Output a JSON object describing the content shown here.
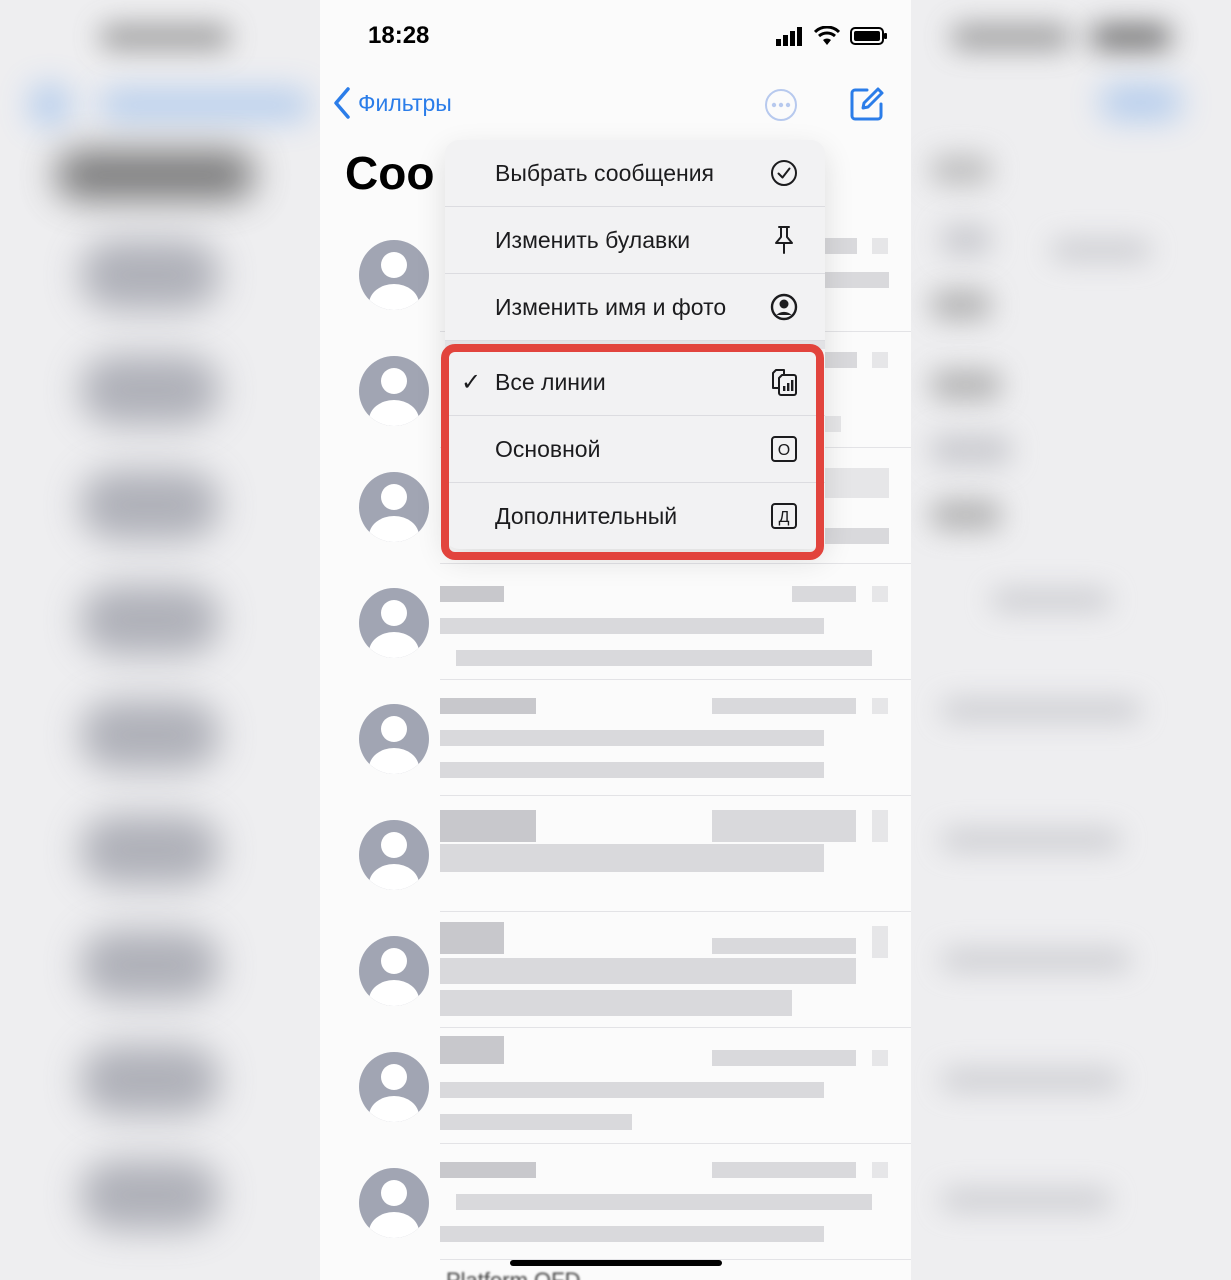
{
  "status_bar": {
    "time": "18:28"
  },
  "nav": {
    "back_label": "Фильтры"
  },
  "title": "Coo",
  "menu": {
    "items": [
      {
        "label": "Выбрать сообщения",
        "icon": "checkmark-circle-icon"
      },
      {
        "label": "Изменить булавки",
        "icon": "pin-icon"
      },
      {
        "label": "Изменить имя и фото",
        "icon": "person-circle-icon"
      }
    ],
    "lines": [
      {
        "label": "Все линии",
        "icon": "sim-all-icon",
        "checked": true,
        "check": "✓"
      },
      {
        "label": "Основной",
        "icon": "sim-primary-icon",
        "checked": false,
        "badge": "О"
      },
      {
        "label": "Дополнительный",
        "icon": "sim-secondary-icon",
        "checked": false,
        "badge": "Д"
      }
    ]
  },
  "highlight_color": "#e2443d",
  "accent_color": "#2b7de9",
  "bottom_peek_text": "Platform OFD"
}
